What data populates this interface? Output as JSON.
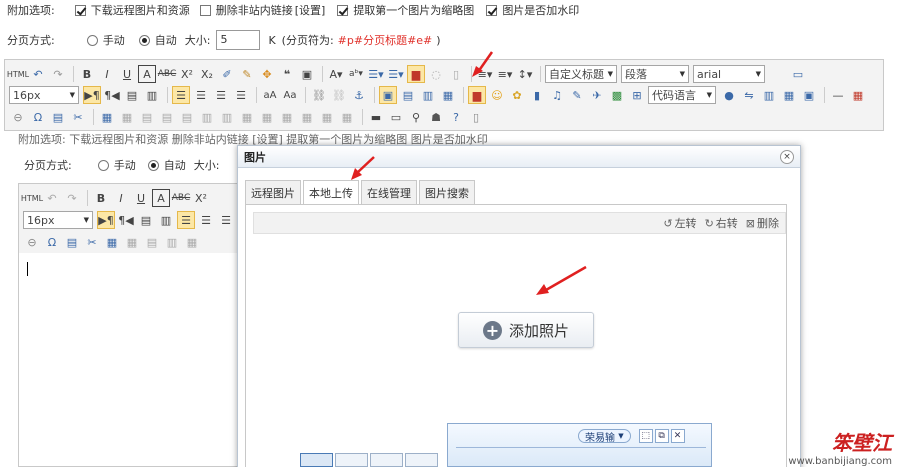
{
  "options_row": {
    "label": "附加选项:",
    "items": [
      {
        "label": "下载远程图片和资源",
        "checked": true
      },
      {
        "label": "删除非站内链接",
        "checked": false,
        "suffix": "[设置]"
      },
      {
        "label": "提取第一个图片为缩略图",
        "checked": true
      },
      {
        "label": "图片是否加水印",
        "checked": true
      }
    ]
  },
  "paging_row": {
    "label": "分页方式:",
    "manual_label": "手动",
    "auto_label": "自动",
    "size_label": "大小:",
    "size_value": "5",
    "unit": "K",
    "symbol_prefix": "(分页符为:",
    "symbol_value": "#p#分页标题#e#",
    "symbol_suffix": ")"
  },
  "toolbar": {
    "font_size": "16px",
    "custom_title": "自定义标题",
    "paragraph": "段落",
    "font_family": "arial",
    "code_language": "代码语言"
  },
  "bg_toolbar": {
    "font_size": "16px"
  },
  "bg_paging": {
    "label": "分页方式:",
    "manual_label": "手动",
    "auto_label": "自动",
    "size_label": "大小:"
  },
  "bg_options_fragment": "附加选项:    下载远程图片和资源    删除非站内链接 [设置]    提取第一个图片为缩略图    图片是否加水印",
  "dialog": {
    "title": "图片",
    "close": "×",
    "tabs": [
      {
        "label": "远程图片",
        "active": false
      },
      {
        "label": "本地上传",
        "active": true
      },
      {
        "label": "在线管理",
        "active": false
      },
      {
        "label": "图片搜索",
        "active": false
      }
    ],
    "tools": {
      "rotate_left": "左转",
      "rotate_right": "右转",
      "delete": "删除"
    },
    "add_button": "添加照片"
  },
  "ime": {
    "label": "荣易输"
  },
  "watermark": {
    "logo": "笨壁江",
    "url": "www.banbijiang.com"
  },
  "colors": {
    "accent_red": "#e0312b",
    "active_icon": "#fce7a6"
  }
}
